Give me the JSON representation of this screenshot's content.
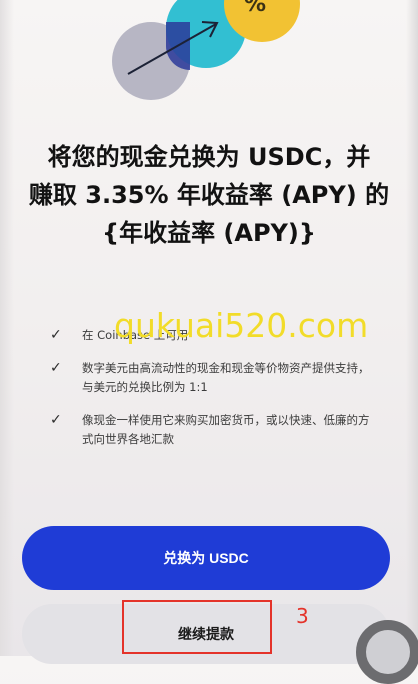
{
  "hero": {
    "badge_symbol": "%"
  },
  "headline": {
    "line1": "将您的现金兑换为 USDC，并",
    "line2": "赚取 3.35% 年收益率 (APY) 的",
    "line3": "{年收益率 (APY)}"
  },
  "features": [
    {
      "text": "在 Coinbase 上可用"
    },
    {
      "text": "数字美元由高流动性的现金和现金等价物资产提供支持，与美元的兑换比例为 1:1"
    },
    {
      "text": "像现金一样使用它来购买加密货币，或以快速、低廉的方式向世界各地汇款"
    }
  ],
  "watermark": "qukuai520.com",
  "buttons": {
    "primary_label": "兑换为 USDC",
    "secondary_label": "继续提款"
  },
  "annotation": {
    "number": "3"
  },
  "colors": {
    "primary_blue": "#1f3cd6",
    "secondary_grey": "#e3e2e6",
    "annotation_red": "#e4332a",
    "watermark_yellow": "#f2dc29"
  }
}
